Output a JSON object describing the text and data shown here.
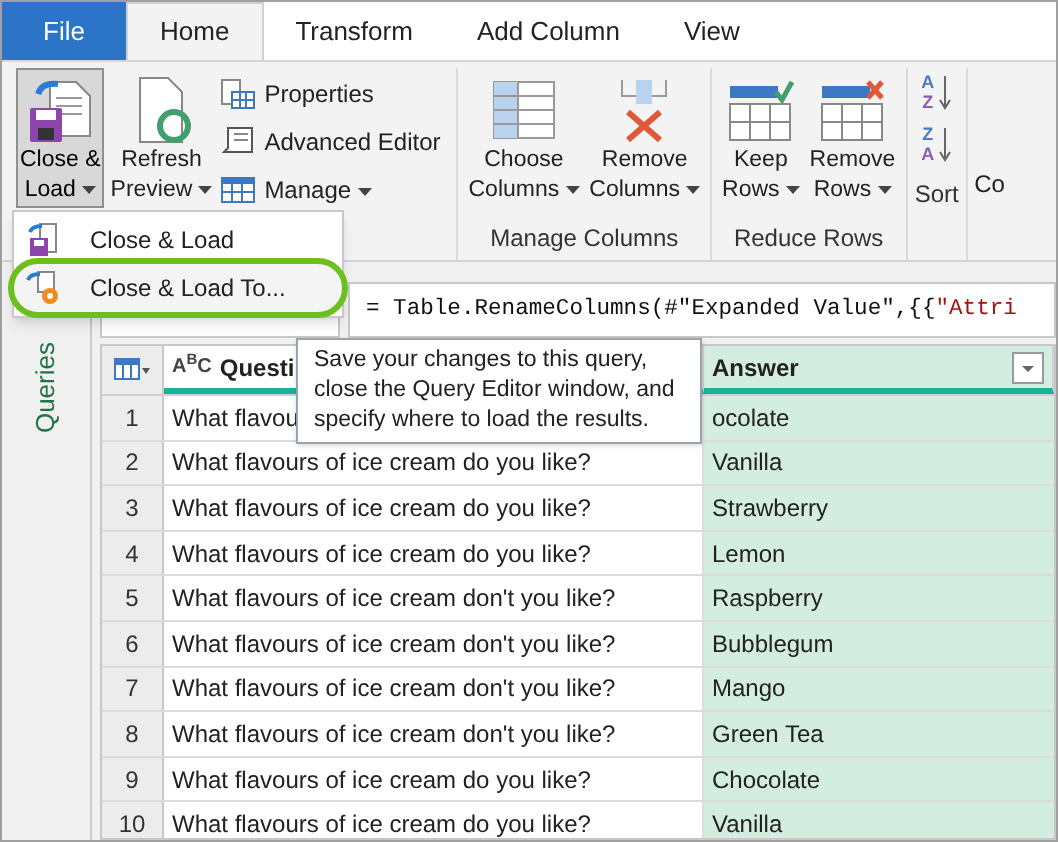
{
  "tabs": [
    {
      "label": "File",
      "kind": "file",
      "selected": false
    },
    {
      "label": "Home",
      "kind": "tab",
      "selected": true
    },
    {
      "label": "Transform",
      "kind": "tab",
      "selected": false
    },
    {
      "label": "Add Column",
      "kind": "tab",
      "selected": false
    },
    {
      "label": "View",
      "kind": "tab",
      "selected": false
    }
  ],
  "ribbon": {
    "groups": [
      {
        "items": [
          {
            "kind": "close_load",
            "lines": [
              "Close &",
              "Load"
            ],
            "dropdown": true,
            "pressed": true
          },
          {
            "kind": "refresh",
            "lines": [
              "Refresh",
              "Preview"
            ],
            "dropdown": true,
            "pressed": false
          },
          {
            "kind": "stack",
            "buttons": [
              {
                "kind": "properties",
                "label": "Properties",
                "dropdown": false
              },
              {
                "kind": "editor",
                "label": "Advanced Editor",
                "dropdown": false
              },
              {
                "kind": "manage",
                "label": "Manage",
                "dropdown": true
              }
            ]
          }
        ]
      },
      {
        "label": "Manage Columns",
        "items": [
          {
            "kind": "choose_columns",
            "lines": [
              "Choose",
              "Columns"
            ],
            "dropdown": true,
            "pressed": false
          },
          {
            "kind": "remove_columns",
            "lines": [
              "Remove",
              "Columns"
            ],
            "dropdown": true,
            "pressed": false
          }
        ]
      },
      {
        "label": "Reduce Rows",
        "items": [
          {
            "kind": "keep_rows",
            "lines": [
              "Keep",
              "Rows"
            ],
            "dropdown": true,
            "pressed": false
          },
          {
            "kind": "remove_rows",
            "lines": [
              "Remove",
              "Rows"
            ],
            "dropdown": true,
            "pressed": false
          }
        ]
      },
      {
        "label": "Sort",
        "items": [
          {
            "kind": "sort",
            "buttons": [
              {
                "top": "A",
                "bottom": "Z"
              },
              {
                "top": "Z",
                "bottom": "A"
              }
            ]
          }
        ]
      },
      {
        "items": [
          {
            "kind": "cut",
            "lines": [
              "Co"
            ]
          }
        ]
      }
    ]
  },
  "menu": {
    "items": [
      {
        "label": "Close & Load",
        "kind": "close_load",
        "selected": false
      },
      {
        "label": "Close & Load To...",
        "kind": "close_load_to",
        "selected": true
      }
    ]
  },
  "tooltip": "Save your changes to this query, close the Query Editor window, and specify where to load the results.",
  "queries_pane": {
    "title": "Queries"
  },
  "formula": [
    {
      "text": "= Table.RenameColumns(#\"Expanded Value\",{{",
      "kind": "code"
    },
    {
      "text": "\"Attri",
      "kind": "string"
    }
  ],
  "table": {
    "columns": [
      {
        "kind": "row_number"
      },
      {
        "type_label": "A$^{B}$C",
        "label": "Questi",
        "selected": false
      },
      {
        "label": "Answer",
        "selected": true
      }
    ],
    "rows": [
      [
        "1",
        "What flavou",
        "ocolate"
      ],
      [
        "2",
        "What flavours of ice cream do you like?",
        "Vanilla"
      ],
      [
        "3",
        "What flavours of ice cream do you like?",
        "Strawberry"
      ],
      [
        "4",
        "What flavours of ice cream do you like?",
        "Lemon"
      ],
      [
        "5",
        "What flavours of ice cream don't you like?",
        "Raspberry"
      ],
      [
        "6",
        "What flavours of ice cream don't you like?",
        "Bubblegum"
      ],
      [
        "7",
        "What flavours of ice cream don't you like?",
        "Mango"
      ],
      [
        "8",
        "What flavours of ice cream don't you like?",
        "Green Tea"
      ],
      [
        "9",
        "What flavours of ice cream do you like?",
        "Chocolate"
      ],
      [
        "10",
        "What flavours of ice cream do you like?",
        "Vanilla"
      ]
    ]
  }
}
